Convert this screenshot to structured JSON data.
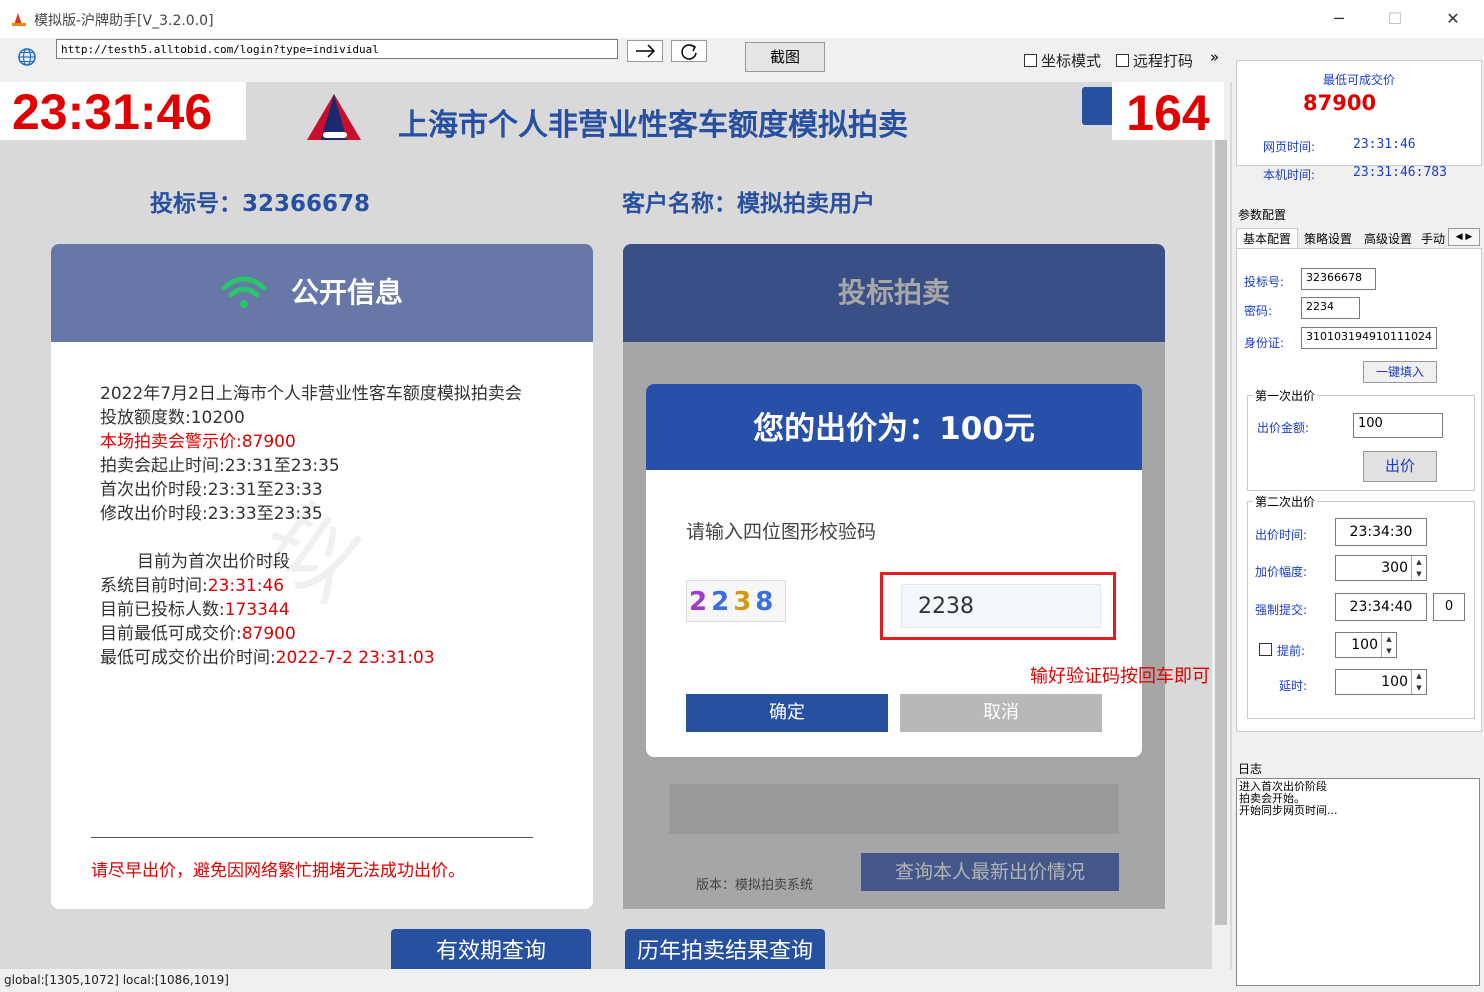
{
  "window": {
    "title": "模拟版-沪牌助手[V_3.2.0.0]",
    "minimize": "─",
    "maximize": "☐",
    "close": "✕"
  },
  "toolbar": {
    "url": "http://testh5.alltobid.com/login?type=individual",
    "go_icon": "arrow-right-icon",
    "refresh_icon": "refresh-icon",
    "screenshot_label": "截图",
    "coord_mode": "坐标模式",
    "remote_captcha": "远程打码",
    "more": "»"
  },
  "overlay": {
    "clock": "23:31:46",
    "counter": "164"
  },
  "page": {
    "title": "上海市个人非营业性客车额度模拟拍卖",
    "bid_no_label": "投标号：32366678",
    "customer_label": "客户名称：模拟拍卖用户",
    "public_info": {
      "header": "公开信息",
      "line1": "2022年7月2日上海市个人非营业性客车额度模拟拍卖会",
      "line2": "投放额度数:10200",
      "line3": "本场拍卖会警示价:87900",
      "line4": "拍卖会起止时间:23:31至23:35",
      "line5": "首次出价时段:23:31至23:33",
      "line6": "修改出价时段:23:33至23:35",
      "line7": "目前为首次出价时段",
      "sys_time_label": "系统目前时间:",
      "sys_time_value": "23:31:46",
      "bidders_label": "目前已投标人数:",
      "bidders_value": "173344",
      "lowest_label": "目前最低可成交价:",
      "lowest_value": "87900",
      "lowest_time_label": "最低可成交价出价时间:",
      "lowest_time_value": "2022-7-2 23:31:03",
      "warning": "请尽早出价，避免因网络繁忙拥堵无法成功出价。"
    },
    "bid_panel": {
      "header": "投标拍卖",
      "version": "版本：模拟拍卖系统",
      "query_btn": "查询本人最新出价情况"
    },
    "dialog": {
      "title": "您的出价为：100元",
      "prompt": "请输入四位图形校验码",
      "captcha": [
        "2",
        "2",
        "3",
        "8"
      ],
      "captcha_input": "2238",
      "hint": "输好验证码按回车即可",
      "ok": "确定",
      "cancel": "取消"
    },
    "bottom_btn1": "有效期查询",
    "bottom_btn2": "历年拍卖结果查询"
  },
  "right_panel": {
    "lowest_title": "最低可成交价",
    "lowest_value": "87900",
    "web_time_label": "网页时间:",
    "web_time_value": "23:31:46",
    "local_time_label": "本机时间:",
    "local_time_value": "23:31:46:783",
    "params_title": "参数配置",
    "tabs": [
      "基本配置",
      "策略设置",
      "高级设置",
      "手动"
    ],
    "bid_no_label": "投标号:",
    "bid_no_value": "32366678",
    "password_label": "密码:",
    "password_value": "2234",
    "id_label": "身份证:",
    "id_value": "310103194910111024",
    "fill_btn": "一键填入",
    "first_bid_title": "第一次出价",
    "amount_label": "出价金额:",
    "amount_value": "100",
    "bid_btn": "出价",
    "second_bid_title": "第二次出价",
    "bid_time_label": "出价时间:",
    "bid_time_value": "23:34:30",
    "increase_label": "加价幅度:",
    "increase_value": "300",
    "force_label": "强制提交:",
    "force_value": "23:34:40",
    "force_extra": "0",
    "advance_label": "提前:",
    "advance_value": "100",
    "delay_label": "延时:",
    "delay_value": "100",
    "log_title": "日志",
    "log_lines": [
      "进入首次出价阶段",
      "拍卖会开始。",
      "开始同步网页时间..."
    ]
  },
  "status": {
    "text": "global:[1305,1072]  local:[1086,1019]"
  }
}
